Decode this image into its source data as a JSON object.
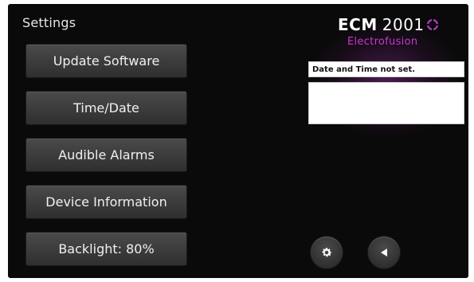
{
  "settings_title": "Settings",
  "menu": [
    {
      "label": "Update Software"
    },
    {
      "label": "Time/Date"
    },
    {
      "label": "Audible Alarms"
    },
    {
      "label": "Device Information"
    },
    {
      "label": "Backlight:  80%"
    }
  ],
  "brand": {
    "ecm": "ECM",
    "model": "2001",
    "subtitle": "Electrofusion",
    "accent_color": "#c43ad0"
  },
  "status_text": "Date and Time not set.",
  "icons": {
    "settings": "gear-icon",
    "back": "back-arrow-icon"
  }
}
